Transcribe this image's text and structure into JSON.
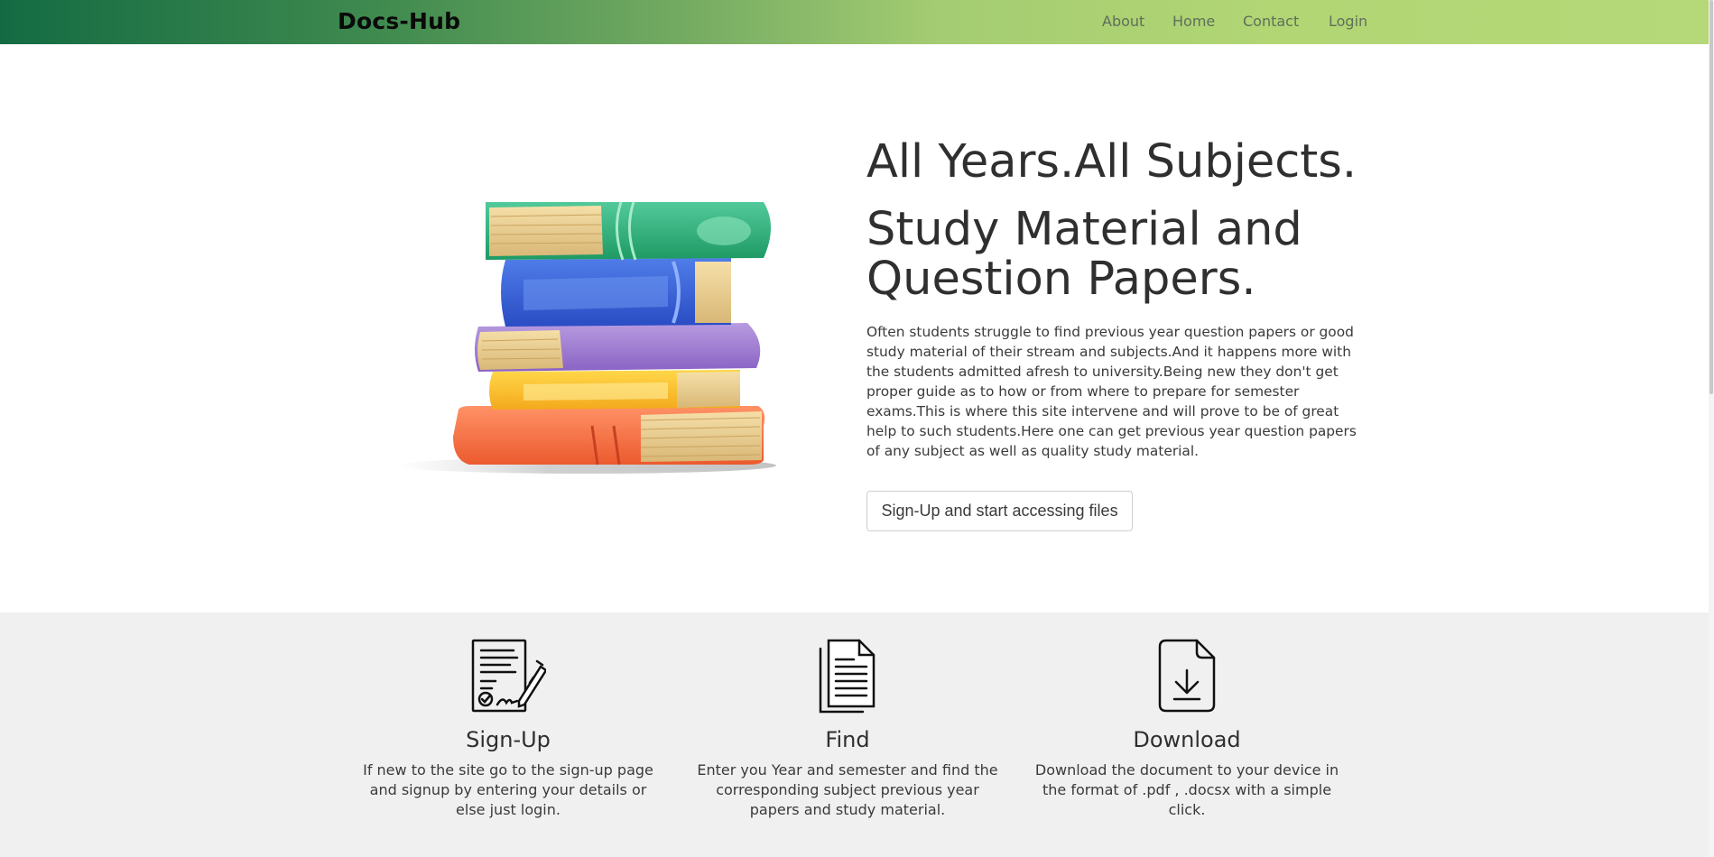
{
  "navbar": {
    "brand": "Docs-Hub",
    "links": [
      "About",
      "Home",
      "Contact",
      "Login"
    ]
  },
  "hero": {
    "title_line1": "All Years.All Subjects.",
    "title_line2": "Study Material and",
    "title_line3": "Question Papers.",
    "description": "Often students struggle to find previous year question papers or good study material of their stream and subjects.And it happens more with the students admitted afresh to university.Being new they don't get proper guide as to how or from where to prepare for semester exams.This is where this site intervene and will prove to be of great help to such students.Here one can get previous year question papers of any subject as well as quality study material.",
    "cta_label": "Sign-Up and start accessing files",
    "image": "stack-of-books-illustration"
  },
  "features": [
    {
      "icon": "contract-signing-icon",
      "title": "Sign-Up",
      "text": "If new to the site go to the sign-up page and signup by entering your details or else just login."
    },
    {
      "icon": "documents-icon",
      "title": "Find",
      "text": "Enter you Year and semester and find the corresponding subject previous year papers and study material."
    },
    {
      "icon": "file-download-icon",
      "title": "Download",
      "text": "Download the document to your device in the format of .pdf , .docsx with a simple click."
    }
  ],
  "colors": {
    "navbar_gradient_start": "#146b43",
    "navbar_gradient_end": "#b5d878",
    "features_background": "#f0f0f0"
  }
}
